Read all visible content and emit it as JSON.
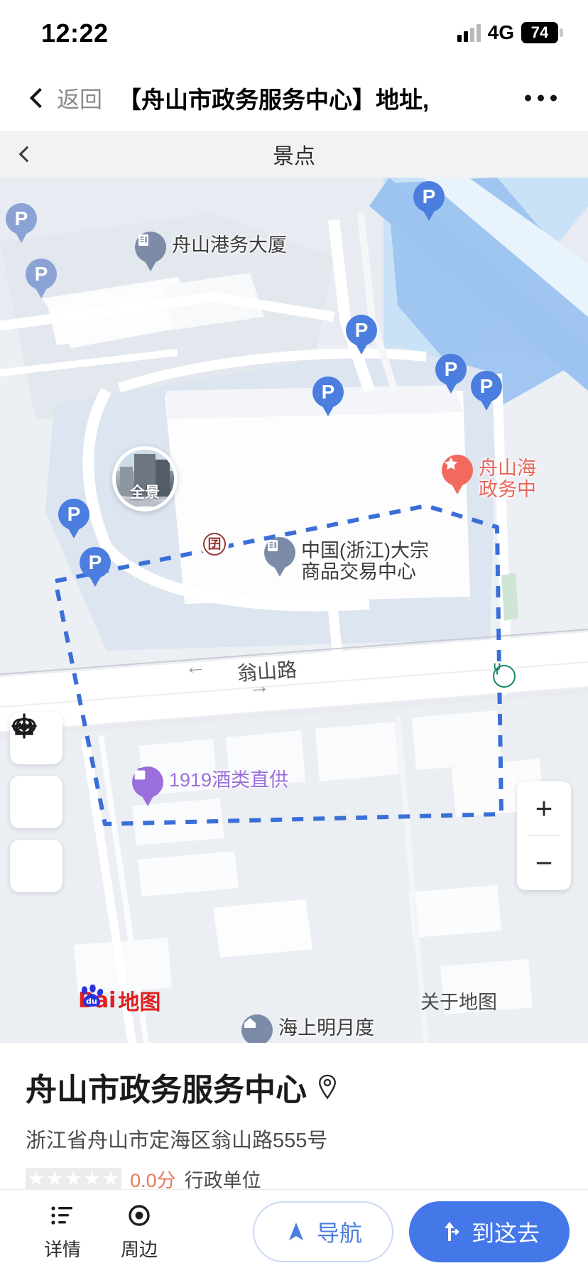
{
  "status_bar": {
    "time": "12:22",
    "network": "4G",
    "battery_level": "74",
    "signal_icon": "signal-bars-icon"
  },
  "nav_bar": {
    "back_icon": "chevron-left-icon",
    "back_label": "返回",
    "title": "【舟山市政务服务中心】地址,...",
    "more_icon": "more-dots-icon"
  },
  "sub_header": {
    "back_icon": "chevron-left-icon",
    "title": "景点"
  },
  "map": {
    "attribution": "Bai du 地图",
    "attribution_parts": {
      "bai": "Bai",
      "du": "du",
      "ditu": "地图"
    },
    "about_label": "关于地图",
    "zoom_in_label": "+",
    "zoom_out_label": "−",
    "panorama_label": "全景",
    "controls": [
      {
        "name": "street-view-toggle-button",
        "icon": "street-view-icon"
      },
      {
        "name": "save-offline-button",
        "icon": "download-icon"
      },
      {
        "name": "locate-me-button",
        "icon": "crosshair-icon"
      }
    ],
    "street_names": [
      "翁山路"
    ],
    "pois": [
      {
        "label": "舟山港务大厦",
        "icon": "building-pin",
        "color": "#7b8ba8"
      },
      {
        "label": "中国(浙江)大宗\n商品交易中心",
        "line1": "中国(浙江)大宗",
        "line2": "商品交易中心",
        "icon": "building-pin",
        "color": "#7b8ba8"
      },
      {
        "label": "舟山海\n政务中",
        "line1": "舟山海",
        "line2": "政务中",
        "icon": "star-pin",
        "color": "#f26a5d"
      },
      {
        "label": "1919酒类直供",
        "icon": "shop-pin",
        "color": "#9b6fdb"
      },
      {
        "label": "海上明月度",
        "icon": "home-pin",
        "color": "#7b8ba8"
      }
    ],
    "parking_markers": [
      {
        "label": "P"
      },
      {
        "label": "P"
      },
      {
        "label": "P"
      },
      {
        "label": "P"
      },
      {
        "label": "P"
      },
      {
        "label": "P"
      },
      {
        "label": "P"
      },
      {
        "label": "P"
      }
    ],
    "bank_marker": {
      "icon": "bank-icon",
      "glyph": "囝"
    },
    "charge_marker": {
      "icon": "ev-charging-icon"
    }
  },
  "info": {
    "title": "舟山市政务服务中心",
    "locate_icon": "location-pin-icon",
    "address": "浙江省舟山市定海区翁山路555号",
    "rating_stars": 0,
    "rating_score": "0.0分",
    "category": "行政单位"
  },
  "bottom_bar": {
    "items": [
      {
        "label": "详情",
        "icon": "list-icon"
      },
      {
        "label": "周边",
        "icon": "nearby-icon"
      }
    ],
    "nav_button": {
      "label": "导航",
      "icon": "navigation-arrow-icon"
    },
    "goto_button": {
      "label": "到这去",
      "icon": "route-arrow-icon"
    }
  },
  "colors": {
    "primary_blue": "#4477e8",
    "link_blue": "#4b7ede",
    "marker_red": "#f26a5d",
    "marker_purple": "#9b6fdb",
    "score_orange": "#e8795b",
    "map_bg": "#eceff4",
    "water": "#9dc3f0"
  }
}
